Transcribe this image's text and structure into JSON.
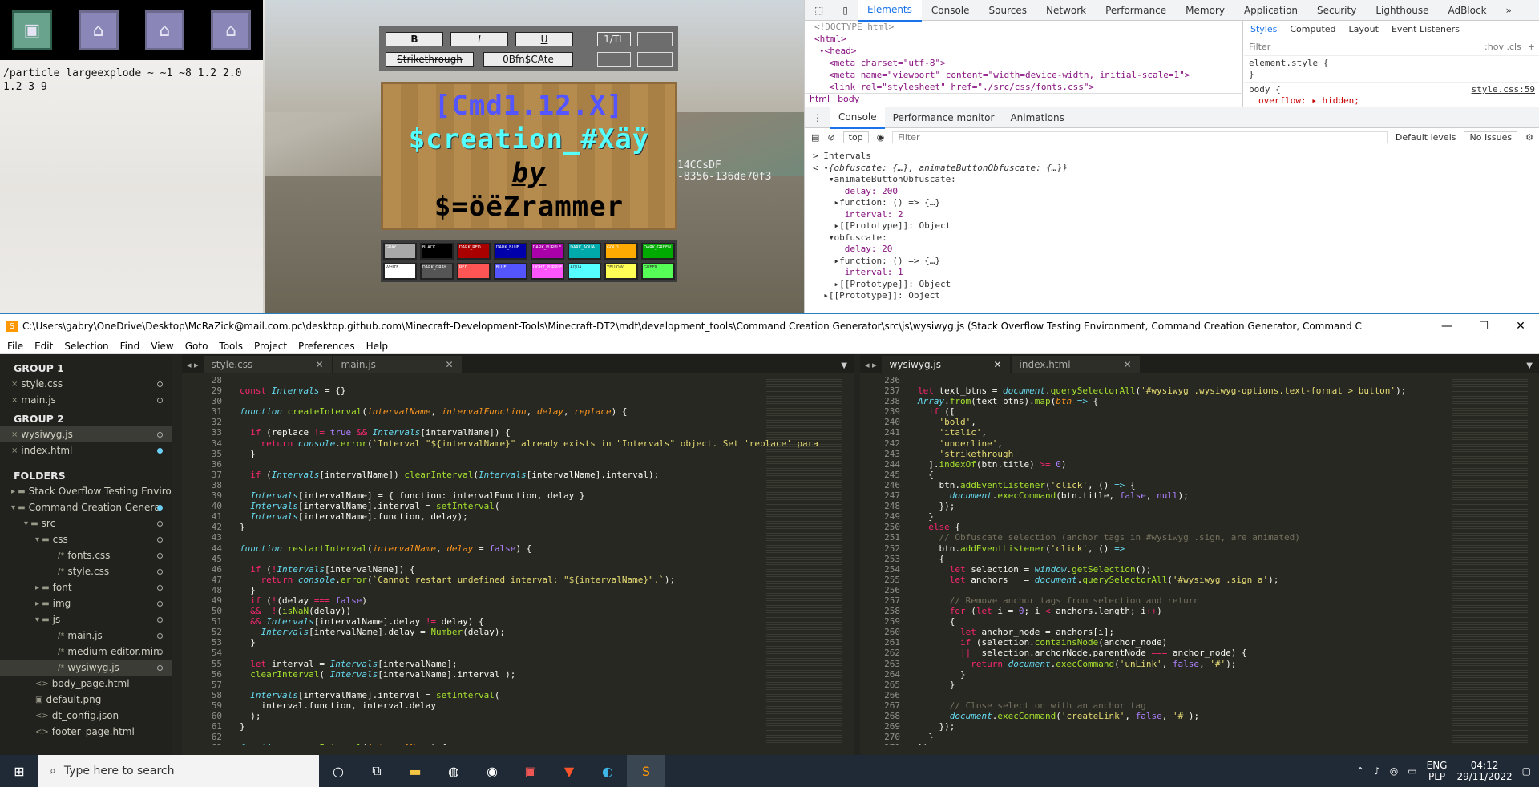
{
  "game": {
    "command_text": "/particle largeexplode ~ ~1 ~8 1.2 2.0 1.2 3 9",
    "uuid_line1": "14CCsDF",
    "uuid_line2": "-8356-136de70f3",
    "format_buttons": [
      "B",
      "I",
      "U",
      "1/TL",
      "Strikethrough",
      "0Bfn$CAte"
    ],
    "sign_lines": [
      "[Cmd1.12.X]",
      "$creation_#Xäÿ",
      "by",
      "$=öëZrammer"
    ],
    "palette": [
      "GRAY",
      "BLACK",
      "DARK_RED",
      "DARK_BLUE",
      "DARK_PURPLE",
      "DARK_AQUA",
      "GOLD",
      "DARK_GREEN",
      "WHITE",
      "DARK_GRAY",
      "RED",
      "BLUE",
      "LIGHT_PURPLE",
      "AQUA",
      "YELLOW",
      "GREEN"
    ],
    "palette_colors": [
      "#a8a8a8",
      "#000000",
      "#aa0000",
      "#0000aa",
      "#aa00aa",
      "#00aaaa",
      "#ffaa00",
      "#00aa00",
      "#ffffff",
      "#555555",
      "#ff5555",
      "#5555ff",
      "#ff55ff",
      "#55ffff",
      "#ffff55",
      "#55ff55"
    ]
  },
  "devtools": {
    "tabs": [
      "Elements",
      "Console",
      "Sources",
      "Network",
      "Performance",
      "Memory",
      "Application",
      "Security",
      "Lighthouse",
      "AdBlock"
    ],
    "elements_lines": [
      "<!DOCTYPE html>",
      "<html>",
      "▾<head>",
      "<meta charset=\"utf-8\">",
      "<meta name=\"viewport\" content=\"width=device-width, initial-scale=1\">",
      "<link rel=\"stylesheet\" href=\"./src/css/fonts.css\">"
    ],
    "crumbs": [
      "html",
      "body"
    ],
    "styles_tabs": [
      "Styles",
      "Computed",
      "Layout",
      "Event Listeners"
    ],
    "styles_filter": "Filter",
    "styles_hov": ":hov .cls",
    "rule1": "element.style {",
    "rule1_end": "}",
    "rule2_sel": "body {",
    "rule2_src": "style.css:59",
    "rule2_prop": "overflow: ▸ hidden;",
    "drawer_tabs": [
      "Console",
      "Performance monitor",
      "Animations"
    ],
    "context": "top",
    "console_filter": "Filter",
    "levels": "Default levels",
    "issues": "No Issues",
    "console_lines": [
      "> Intervals",
      "< ▾{obfuscate: {…}, animateButtonObfuscate: {…}}",
      "   ▾animateButtonObfuscate:",
      "      delay: 200",
      "    ▸function: () => {…}",
      "      interval: 2",
      "    ▸[[Prototype]]: Object",
      "   ▾obfuscate:",
      "      delay: 20",
      "    ▸function: () => {…}",
      "      interval: 1",
      "    ▸[[Prototype]]: Object",
      "  ▸[[Prototype]]: Object"
    ]
  },
  "editor": {
    "title": "C:\\Users\\gabry\\OneDrive\\Desktop\\McRaZick@mail.com.pc\\desktop.github.com\\Minecraft-Development-Tools\\Minecraft-DT2\\mdt\\development_tools\\Command Creation Generator\\src\\js\\wysiwyg.js (Stack Overflow Testing Environment, Command Creation Generator, Command C",
    "menu": [
      "File",
      "Edit",
      "Selection",
      "Find",
      "View",
      "Goto",
      "Tools",
      "Project",
      "Preferences",
      "Help"
    ],
    "sidebar": [
      {
        "t": "hdr",
        "label": "GROUP 1"
      },
      {
        "t": "file",
        "label": "style.css",
        "indent": 14,
        "icon": "×",
        "dot": "o"
      },
      {
        "t": "file",
        "label": "main.js",
        "indent": 14,
        "icon": "×",
        "dot": "o"
      },
      {
        "t": "hdr",
        "label": "GROUP 2"
      },
      {
        "t": "file",
        "label": "wysiwyg.js",
        "indent": 14,
        "icon": "×",
        "dot": "o",
        "sel": true
      },
      {
        "t": "file",
        "label": "index.html",
        "indent": 14,
        "icon": "×",
        "dot": "fill"
      },
      {
        "t": "gap",
        "label": ""
      },
      {
        "t": "hdr",
        "label": "FOLDERS"
      },
      {
        "t": "file",
        "label": "Stack Overflow Testing Enviror",
        "indent": 14,
        "icon": "▸ ▬"
      },
      {
        "t": "file",
        "label": "Command Creation Genera",
        "indent": 14,
        "icon": "▾ ▬",
        "dot": "fill"
      },
      {
        "t": "file",
        "label": "src",
        "indent": 30,
        "icon": "▾ ▬",
        "dot": "o"
      },
      {
        "t": "file",
        "label": "css",
        "indent": 44,
        "icon": "▾ ▬",
        "dot": "o"
      },
      {
        "t": "file",
        "label": "fonts.css",
        "indent": 72,
        "icon": "/*",
        "dot": "o"
      },
      {
        "t": "file",
        "label": "style.css",
        "indent": 72,
        "icon": "/*",
        "dot": "o"
      },
      {
        "t": "file",
        "label": "font",
        "indent": 44,
        "icon": "▸ ▬",
        "dot": "o"
      },
      {
        "t": "file",
        "label": "img",
        "indent": 44,
        "icon": "▸ ▬",
        "dot": "o"
      },
      {
        "t": "file",
        "label": "js",
        "indent": 44,
        "icon": "▾ ▬",
        "dot": "o"
      },
      {
        "t": "file",
        "label": "main.js",
        "indent": 72,
        "icon": "/*",
        "dot": "o"
      },
      {
        "t": "file",
        "label": "medium-editor.min.",
        "indent": 72,
        "icon": "/*",
        "dot": "o"
      },
      {
        "t": "file",
        "label": "wysiwyg.js",
        "indent": 72,
        "icon": "/*",
        "dot": "o",
        "sel": true
      },
      {
        "t": "file",
        "label": "body_page.html",
        "indent": 44,
        "icon": "<>"
      },
      {
        "t": "file",
        "label": "default.png",
        "indent": 44,
        "icon": "▣"
      },
      {
        "t": "file",
        "label": "dt_config.json",
        "indent": 44,
        "icon": "<>"
      },
      {
        "t": "file",
        "label": "footer_page.html",
        "indent": 44,
        "icon": "<>"
      }
    ],
    "left_tabs": [
      "style.css",
      "main.js"
    ],
    "right_tabs": [
      "wysiwyg.js",
      "index.html"
    ],
    "left_start": 28,
    "right_start": 236,
    "taskbar_search": "Type here to search",
    "tray_lang1": "ENG",
    "tray_lang2": "PLP",
    "time": "04:12",
    "date": "29/11/2022"
  }
}
